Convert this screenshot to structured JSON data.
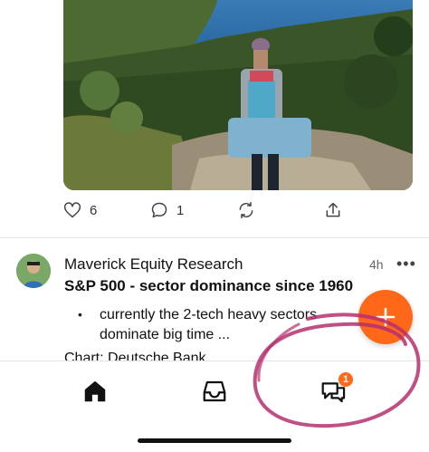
{
  "post_actions": {
    "like_count": "6",
    "comment_count": "1"
  },
  "post": {
    "author": "Maverick Equity Research",
    "time": "4h",
    "more_label": "•••",
    "title": "S&P 500 - sector dominance since 1960",
    "bullet": "•",
    "bullet_text": "currently the 2-tech heavy sectors dominate big time ...",
    "cut_text": "Chart: Deutsche Bank"
  },
  "fab": {
    "label": "+"
  },
  "nav": {
    "items": [
      {
        "icon": "home-icon"
      },
      {
        "icon": "inbox-icon"
      },
      {
        "icon": "chat-icon",
        "badge": "1"
      }
    ]
  },
  "colors": {
    "accent": "#ff6719",
    "annotation": "#b5306f"
  }
}
